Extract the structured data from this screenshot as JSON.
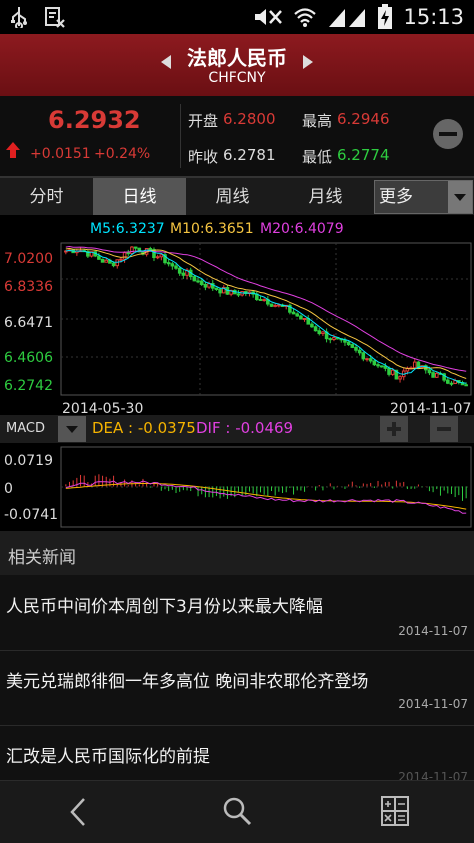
{
  "status_bar": {
    "time": "15:13",
    "icons": [
      "usb-icon",
      "document-x-icon",
      "mute-icon",
      "wifi-icon",
      "signal-icon",
      "battery-charging-icon"
    ]
  },
  "header": {
    "title": "法郎人民币",
    "code": "CHFCNY",
    "prev_icon": "triangle-left-icon",
    "next_icon": "triangle-right-icon"
  },
  "quote": {
    "price": "6.2932",
    "change": "+0.0151",
    "change_pct": "+0.24%",
    "open_label": "开盘",
    "open_value": "6.2800",
    "high_label": "最高",
    "high_value": "6.2946",
    "prev_close_label": "昨收",
    "prev_close_value": "6.2781",
    "low_label": "最低",
    "low_value": "6.2774",
    "colors": {
      "up": "#d83a36",
      "down": "#2ecc40"
    }
  },
  "tabs": {
    "items": [
      "分时",
      "日线",
      "周线",
      "月线"
    ],
    "active": "日线",
    "more_label": "更多"
  },
  "chart": {
    "ma_legend": {
      "m5": "M5:6.3237",
      "m10": "M10:6.3651",
      "m20": "M20:6.4079"
    },
    "colors": {
      "m5": "#00e5ff",
      "m10": "#f5c542",
      "m20": "#e040e0",
      "dea": "#f5b300",
      "dif": "#e040e0"
    },
    "macd_label": "MACD",
    "dea_text": "DEA : -0.0375",
    "dif_text": "DIF : -0.0469"
  },
  "chart_data": [
    {
      "type": "candlestick",
      "title": "",
      "ylabels": [
        "7.0200",
        "6.8336",
        "6.6471",
        "6.4606",
        "6.2742"
      ],
      "ylim": [
        6.2742,
        7.02
      ],
      "xlabels": [
        "2014-05-30",
        "2014-11-07"
      ],
      "ma": {
        "M5": 6.3237,
        "M10": 6.3651,
        "M20": 6.4079
      },
      "close_trend": [
        7.0,
        7.01,
        6.99,
        6.96,
        6.93,
        6.97,
        7.02,
        7.0,
        6.98,
        6.95,
        6.9,
        6.88,
        6.84,
        6.82,
        6.8,
        6.78,
        6.79,
        6.77,
        6.75,
        6.72,
        6.7,
        6.66,
        6.62,
        6.58,
        6.55,
        6.52,
        6.49,
        6.46,
        6.42,
        6.38,
        6.36,
        6.42,
        6.4,
        6.37,
        6.35,
        6.33,
        6.3
      ]
    },
    {
      "type": "macd",
      "title": "",
      "ylabels": [
        "0.0719",
        "0",
        "-0.0741"
      ],
      "ylim": [
        -0.0741,
        0.0719
      ],
      "dea": -0.0375,
      "dif": -0.0469
    }
  ],
  "news": {
    "header": "相关新闻",
    "items": [
      {
        "title": "人民币中间价本周创下3月份以来最大降幅",
        "date": "2014-11-07"
      },
      {
        "title": "美元兑瑞郎徘徊一年多高位 晚间非农耶伦齐登场",
        "date": "2014-11-07"
      },
      {
        "title": "汇改是人民币国际化的前提",
        "date": "2014-11-07"
      }
    ]
  },
  "bottom_nav": {
    "icons": [
      "back-icon",
      "search-icon",
      "calculator-icon"
    ]
  }
}
